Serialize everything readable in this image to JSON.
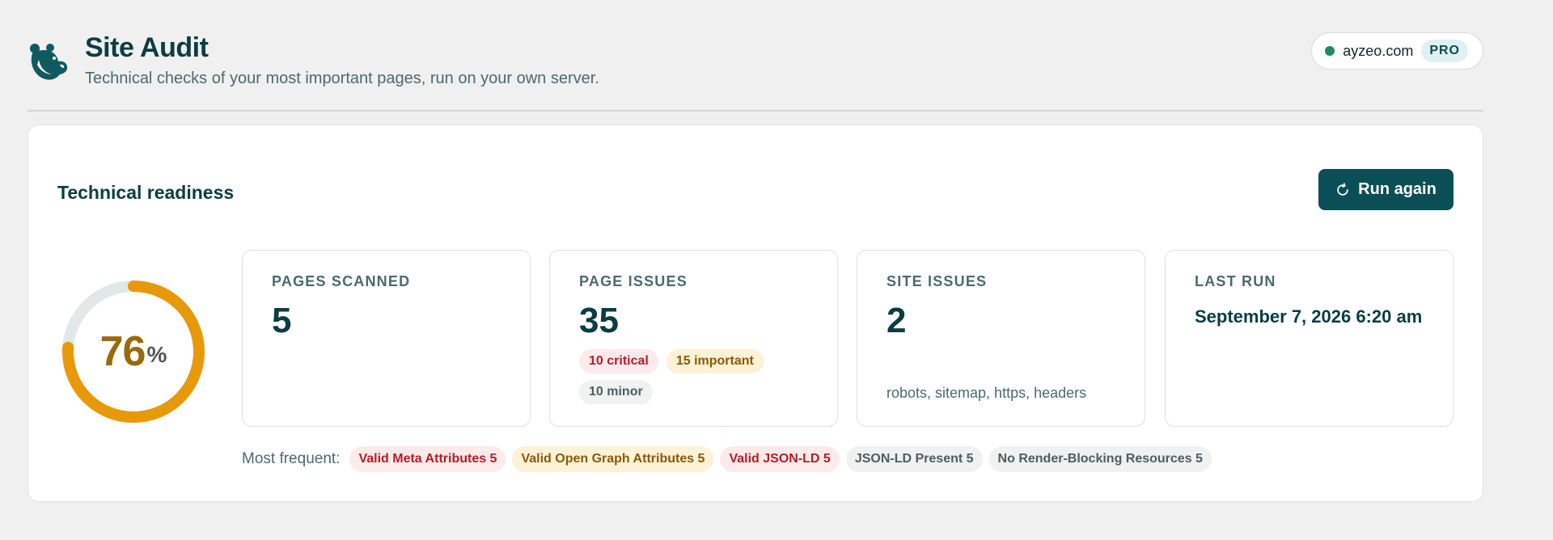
{
  "header": {
    "title": "Site Audit",
    "subtitle": "Technical checks of your most important pages, run on your own server.",
    "site": "ayzeo.com",
    "plan_badge": "PRO",
    "status_color": "#1f8a5f"
  },
  "card": {
    "title": "Technical readiness",
    "run_button": "Run again",
    "score": {
      "value": "76",
      "unit": "%",
      "fraction": 0.76
    },
    "stats": {
      "pages_scanned": {
        "label": "PAGES SCANNED",
        "value": "5"
      },
      "page_issues": {
        "label": "PAGE ISSUES",
        "value": "35",
        "critical": "10 critical",
        "important": "15 important",
        "minor": "10 minor"
      },
      "site_issues": {
        "label": "SITE ISSUES",
        "value": "2",
        "note": "robots, sitemap, https, headers"
      },
      "last_run": {
        "label": "LAST RUN",
        "value": "September 7, 2026 6:20 am"
      }
    },
    "frequent": {
      "label": "Most frequent:",
      "items": [
        {
          "text": "Valid Meta Attributes 5",
          "severity": "critical"
        },
        {
          "text": "Valid Open Graph Attributes 5",
          "severity": "important"
        },
        {
          "text": "Valid JSON-LD 5",
          "severity": "critical"
        },
        {
          "text": "JSON-LD Present 5",
          "severity": "minor"
        },
        {
          "text": "No Render-Blocking Resources 5",
          "severity": "minor"
        }
      ]
    }
  },
  "colors": {
    "brand": "#0a4f55",
    "gauge": "#e8990a",
    "gauge_track": "#e2e8e8"
  }
}
